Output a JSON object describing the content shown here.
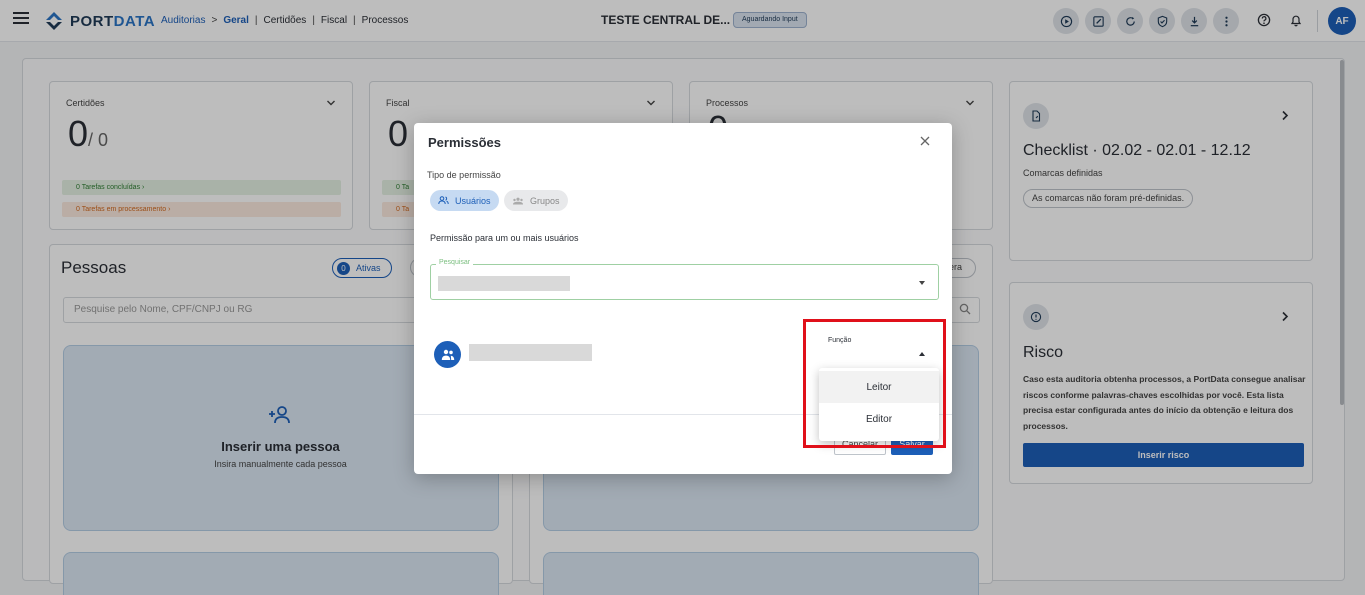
{
  "header": {
    "brand_a": "PORT",
    "brand_b": "DATA",
    "breadcrumbs": [
      {
        "label": "Auditorias",
        "type": "link"
      },
      {
        "label": ">",
        "type": "sep"
      },
      {
        "label": "Geral",
        "type": "active"
      },
      {
        "label": "|",
        "type": "sep"
      },
      {
        "label": "Certidões",
        "type": "item"
      },
      {
        "label": "|",
        "type": "sep"
      },
      {
        "label": "Fiscal",
        "type": "item"
      },
      {
        "label": "|",
        "type": "sep"
      },
      {
        "label": "Processos",
        "type": "item"
      }
    ],
    "title": "TESTE CENTRAL DE...",
    "status": "Aguardando Input",
    "avatar": "AF",
    "icons": [
      "play-icon",
      "edit-icon",
      "refresh-icon",
      "shield-check-icon",
      "download-icon",
      "more-vert-icon",
      "help-icon",
      "bell-icon"
    ]
  },
  "cards": {
    "certidoes": {
      "label": "Certidões",
      "value": "0",
      "total": "/ 0",
      "done": "0 Tarefas concluídas",
      "processing": "0 Tarefas em processamento"
    },
    "fiscal": {
      "label": "Fiscal",
      "value": "0",
      "done": "0 Ta",
      "processing": "0 Ta"
    },
    "processos": {
      "label": "Processos",
      "value": "0"
    }
  },
  "pessoas": {
    "title": "Pessoas",
    "active_count": "0",
    "active_label": "Ativas",
    "right_chip": "era",
    "search_placeholder": "Pesquise pelo Nome, CPF/CNPJ ou RG",
    "add_title": "Inserir uma pessoa",
    "add_subtitle": "Insira manualmente cada pessoa"
  },
  "checklist": {
    "title": "Checklist · 02.02 - 02.01 - 12.12",
    "subtitle": "Comarcas definidas",
    "chip": "As comarcas não foram pré-definidas."
  },
  "risco": {
    "title": "Risco",
    "text": "Caso esta auditoria obtenha processos, a PortData consegue analisar riscos conforme palavras-chaves escolhidas por você. Esta lista precisa estar configurada antes do início da obtenção e leitura dos processos.",
    "button": "Inserir risco"
  },
  "modal": {
    "title": "Permissões",
    "perm_type_label": "Tipo de permissão",
    "tab_users": "Usuários",
    "tab_groups": "Grupos",
    "description": "Permissão para um ou mais usuários",
    "search_legend": "Pesquisar",
    "role_label": "Função",
    "cancel": "Cancelar",
    "save": "Salvar"
  },
  "role_menu": {
    "options": [
      "Leitor",
      "Editor"
    ],
    "hovered": "Leitor"
  },
  "colors": {
    "primary": "#1d5fb8",
    "highlight": "#e0101a"
  }
}
